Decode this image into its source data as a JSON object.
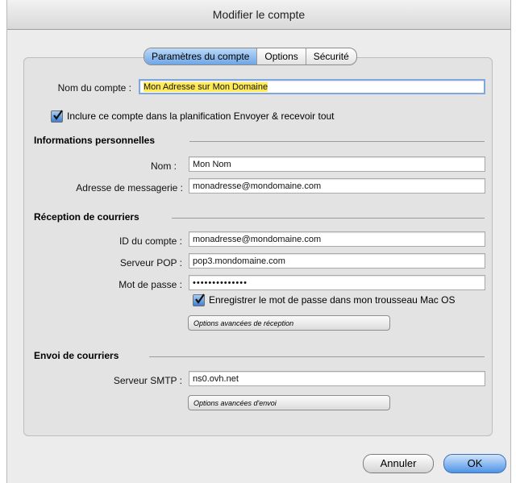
{
  "window": {
    "title": "Modifier le compte"
  },
  "tabs": [
    {
      "label": "Paramètres du compte",
      "active": true
    },
    {
      "label": "Options",
      "active": false
    },
    {
      "label": "Sécurité",
      "active": false
    }
  ],
  "account": {
    "name_label": "Nom du compte :",
    "name_value": "Mon Adresse sur Mon Domaine",
    "include_label": "Inclure ce compte dans la planification Envoyer & recevoir tout",
    "include_checked": true
  },
  "personal": {
    "heading": "Informations personnelles",
    "name_label": "Nom :",
    "name_value": "Mon Nom",
    "email_label": "Adresse de messagerie :",
    "email_value": "monadresse@mondomaine.com"
  },
  "incoming": {
    "heading": "Réception de courriers",
    "id_label": "ID du compte :",
    "id_value": "monadresse@mondomaine.com",
    "pop_label": "Serveur POP :",
    "pop_value": "pop3.mondomaine.com",
    "password_label": "Mot de passe :",
    "password_value": "••••••••••••••",
    "save_password_label": "Enregistrer le mot de passe dans mon trousseau Mac OS",
    "save_password_checked": true,
    "advanced_label": "Options avancées de réception"
  },
  "outgoing": {
    "heading": "Envoi de courriers",
    "smtp_label": "Serveur SMTP :",
    "smtp_value": "ns0.ovh.net",
    "advanced_label": "Options avancées d'envoi"
  },
  "buttons": {
    "cancel": "Annuler",
    "ok": "OK"
  },
  "colors": {
    "accent": "#5b9be8",
    "highlight": "#ffeb5a",
    "background": "#ececec"
  }
}
